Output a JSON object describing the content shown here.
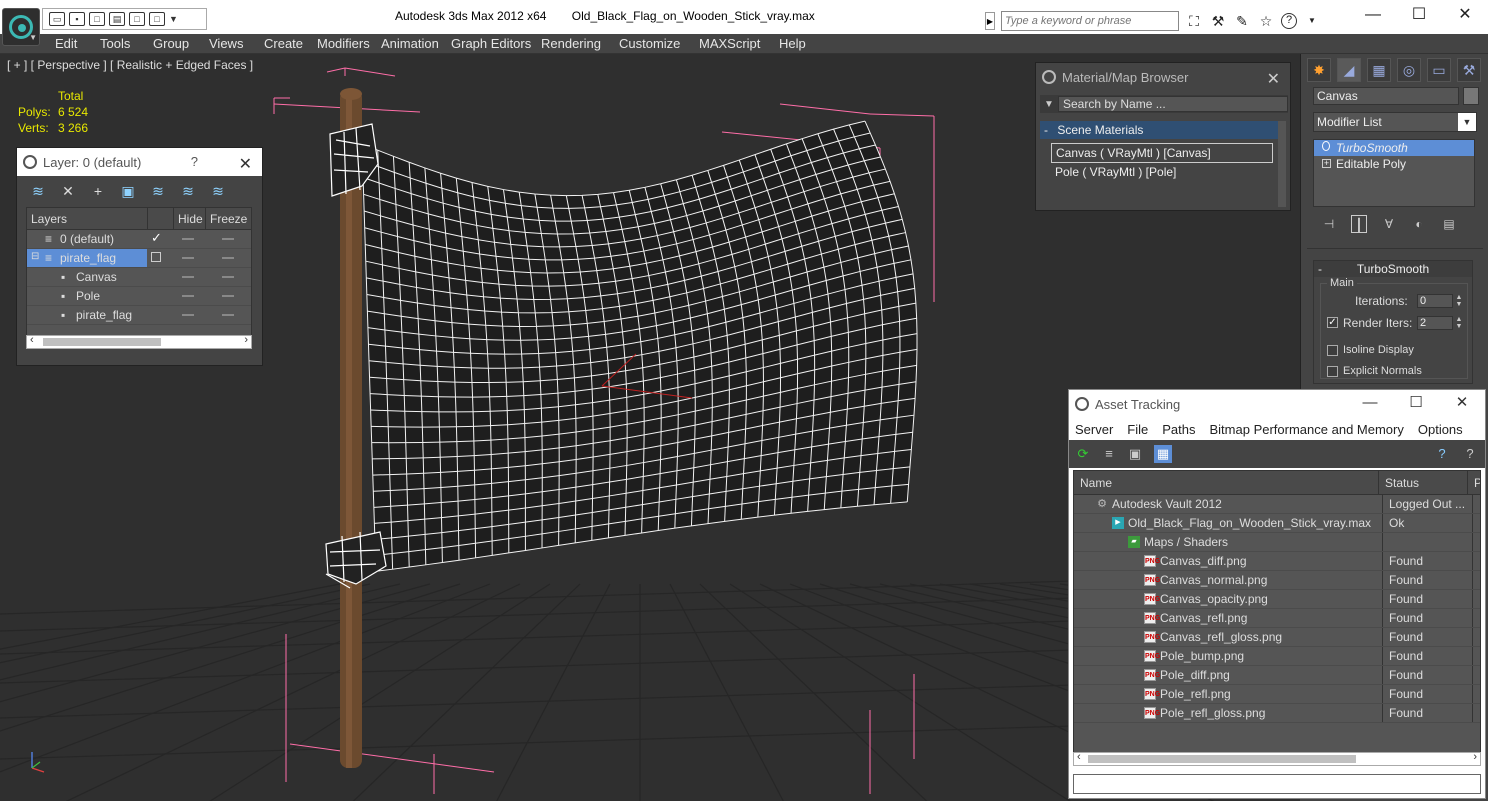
{
  "titlebar": {
    "app_name": "Autodesk 3ds Max  2012 x64",
    "file_name": "Old_Black_Flag_on_Wooden_Stick_vray.max",
    "search_placeholder": "Type a keyword or phrase"
  },
  "menu": [
    "Edit",
    "Tools",
    "Group",
    "Views",
    "Create",
    "Modifiers",
    "Animation",
    "Graph Editors",
    "Rendering",
    "Customize",
    "MAXScript",
    "Help"
  ],
  "viewport": {
    "label": "[ + ] [ Perspective ] [ Realistic + Edged Faces ]",
    "stats": {
      "header": "Total",
      "polys_label": "Polys:",
      "polys_value": "6 524",
      "verts_label": "Verts:",
      "verts_value": "3 266"
    }
  },
  "layer_panel": {
    "title": "Layer: 0 (default)",
    "help": "?",
    "columns": [
      "Layers",
      "Hide",
      "Freeze"
    ],
    "rows": [
      {
        "name": "0 (default)",
        "indent": 0
      },
      {
        "name": "pirate_flag",
        "indent": 0
      },
      {
        "name": "Canvas",
        "indent": 1
      },
      {
        "name": "Pole",
        "indent": 1
      },
      {
        "name": "pirate_flag",
        "indent": 1
      }
    ]
  },
  "material_browser": {
    "title": "Material/Map Browser",
    "search_placeholder": "Search by Name ...",
    "section": "Scene Materials",
    "items": [
      "Canvas  ( VRayMtl ) [Canvas]",
      "Pole  ( VRayMtl ) [Pole]"
    ]
  },
  "command_panel": {
    "object_name": "Canvas",
    "modifier_list": "Modifier List",
    "stack": [
      "TurboSmooth",
      "Editable Poly"
    ],
    "rollout_title": "TurboSmooth",
    "main_label": "Main",
    "iterations_label": "Iterations:",
    "iterations_value": "0",
    "render_iters_label": "Render Iters:",
    "render_iters_value": "2",
    "isoline_label": "Isoline Display",
    "explicit_normals_label": "Explicit Normals"
  },
  "asset_tracking": {
    "title": "Asset Tracking",
    "menu": [
      "Server",
      "File",
      "Paths",
      "Bitmap Performance and Memory",
      "Options"
    ],
    "columns": [
      "Name",
      "Status",
      "P"
    ],
    "rows": [
      {
        "name": "Autodesk Vault 2012",
        "status": "Logged Out ...",
        "icon": "vault",
        "indent": 0
      },
      {
        "name": "Old_Black_Flag_on_Wooden_Stick_vray.max",
        "status": "Ok",
        "icon": "max",
        "indent": 1
      },
      {
        "name": "Maps / Shaders",
        "status": "",
        "icon": "maps",
        "indent": 2
      },
      {
        "name": "Canvas_diff.png",
        "status": "Found",
        "icon": "png",
        "indent": 3
      },
      {
        "name": "Canvas_normal.png",
        "status": "Found",
        "icon": "png",
        "indent": 3
      },
      {
        "name": "Canvas_opacity.png",
        "status": "Found",
        "icon": "png",
        "indent": 3
      },
      {
        "name": "Canvas_refl.png",
        "status": "Found",
        "icon": "png",
        "indent": 3
      },
      {
        "name": "Canvas_refl_gloss.png",
        "status": "Found",
        "icon": "png",
        "indent": 3
      },
      {
        "name": "Pole_bump.png",
        "status": "Found",
        "icon": "png",
        "indent": 3
      },
      {
        "name": "Pole_diff.png",
        "status": "Found",
        "icon": "png",
        "indent": 3
      },
      {
        "name": "Pole_refl.png",
        "status": "Found",
        "icon": "png",
        "indent": 3
      },
      {
        "name": "Pole_refl_gloss.png",
        "status": "Found",
        "icon": "png",
        "indent": 3
      }
    ]
  },
  "colors": {
    "accent": "#5d8ed6",
    "stats": "#e8e800",
    "viewport_bg": "#2f2f2f",
    "bbox_pink": "#ff6ea8"
  }
}
